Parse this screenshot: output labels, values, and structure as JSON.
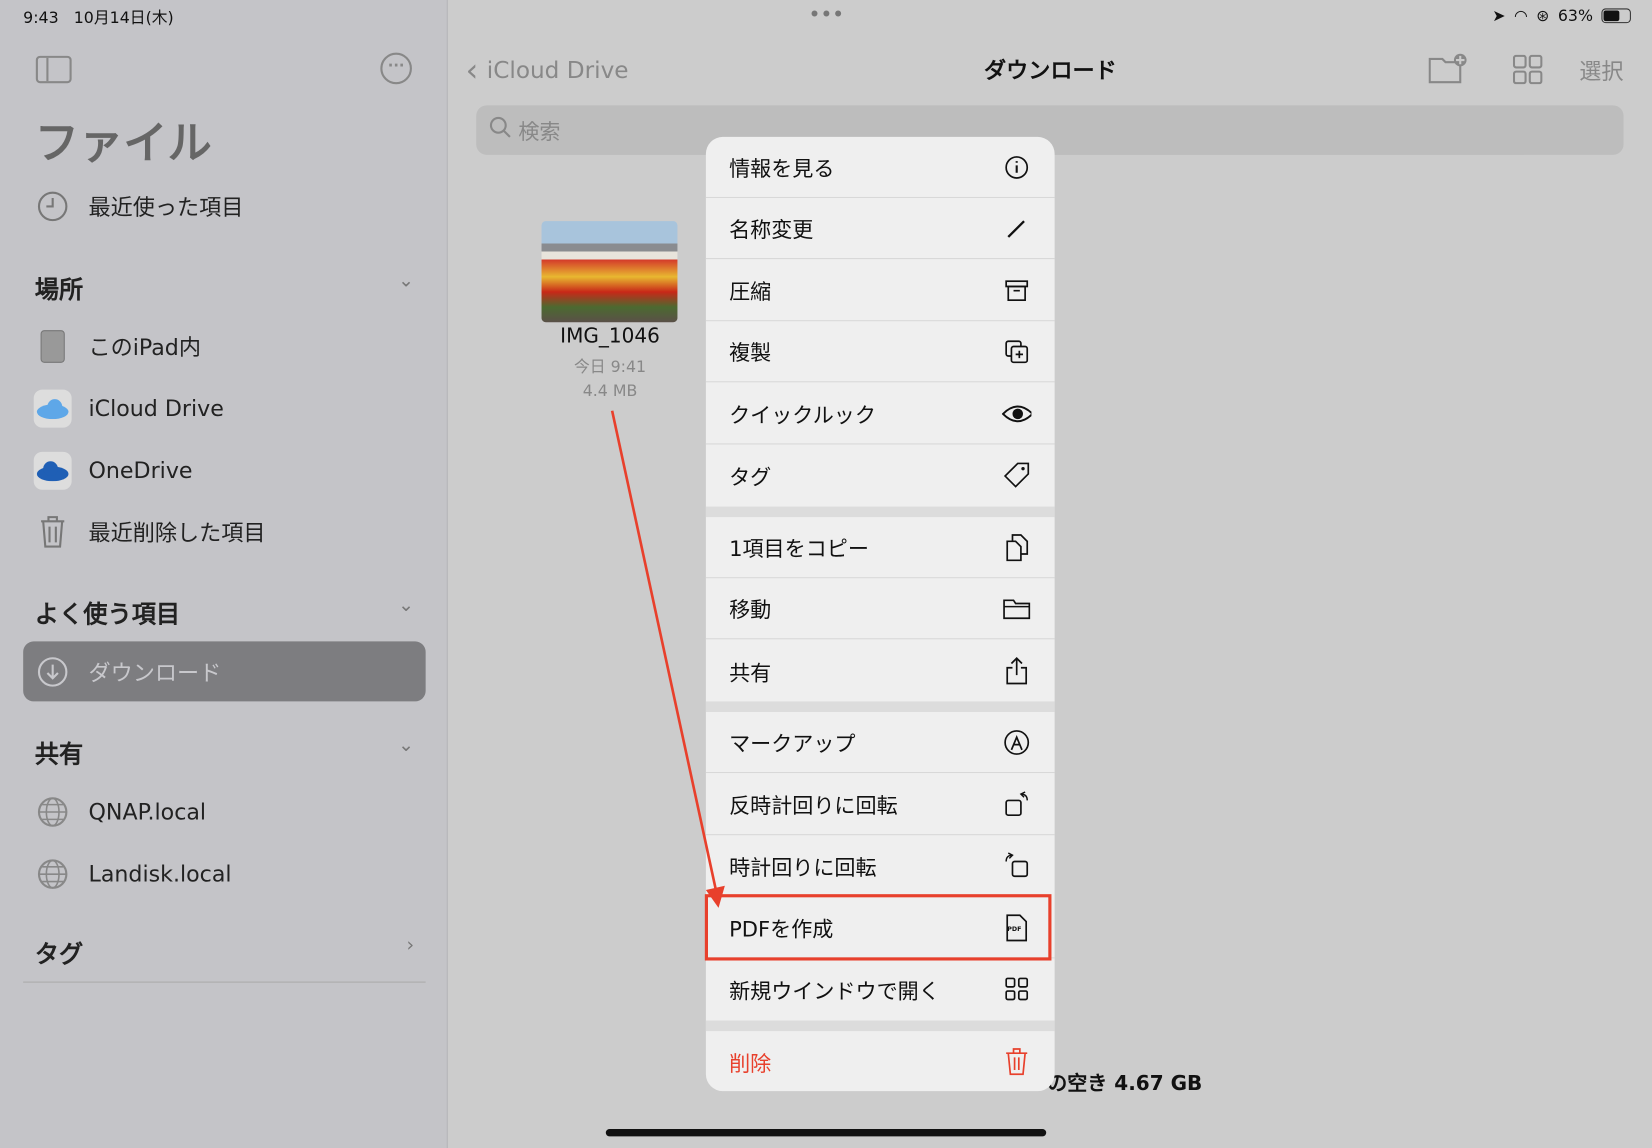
{
  "status_bar": {
    "time": "9:43",
    "date": "10月14日(木)",
    "battery": "63%"
  },
  "sidebar": {
    "title": "ファイル",
    "recent": "最近使った項目",
    "locations_header": "場所",
    "locations": [
      {
        "label": "このiPad内",
        "icon": "ipad-icon"
      },
      {
        "label": "iCloud Drive",
        "icon": "icloud-icon"
      },
      {
        "label": "OneDrive",
        "icon": "onedrive-icon"
      },
      {
        "label": "最近削除した項目",
        "icon": "trash-icon"
      }
    ],
    "favorites_header": "よく使う項目",
    "favorites": [
      {
        "label": "ダウンロード",
        "icon": "download-icon",
        "selected": true
      }
    ],
    "shared_header": "共有",
    "shared": [
      {
        "label": "QNAP.local",
        "icon": "globe-icon"
      },
      {
        "label": "Landisk.local",
        "icon": "globe-icon"
      }
    ],
    "tags_header": "タグ"
  },
  "nav": {
    "back_label": "iCloud Drive",
    "title": "ダウンロード",
    "select_label": "選択"
  },
  "search": {
    "placeholder": "検索"
  },
  "file": {
    "name": "IMG_1046",
    "date": "今日 9:41",
    "size": "4.4 MB"
  },
  "footer": {
    "storage": "の空き 4.67 GB"
  },
  "menu": {
    "items": [
      {
        "label": "情報を見る",
        "icon": "info-icon"
      },
      {
        "label": "名称変更",
        "icon": "pencil-icon"
      },
      {
        "label": "圧縮",
        "icon": "archive-icon"
      },
      {
        "label": "複製",
        "icon": "duplicate-icon"
      },
      {
        "label": "クイックルック",
        "icon": "eye-icon"
      },
      {
        "label": "タグ",
        "icon": "tag-icon"
      },
      {
        "label": "1項目をコピー",
        "icon": "copy-icon"
      },
      {
        "label": "移動",
        "icon": "folder-icon"
      },
      {
        "label": "共有",
        "icon": "share-icon"
      },
      {
        "label": "マークアップ",
        "icon": "markup-icon"
      },
      {
        "label": "反時計回りに回転",
        "icon": "rotate-left-icon"
      },
      {
        "label": "時計回りに回転",
        "icon": "rotate-right-icon"
      },
      {
        "label": "PDFを作成",
        "icon": "pdf-icon"
      },
      {
        "label": "新規ウインドウで開く",
        "icon": "window-icon"
      },
      {
        "label": "削除",
        "icon": "trash-icon"
      }
    ],
    "pdf_badge": "PDF"
  },
  "colors": {
    "destructive": "#e8402c",
    "annotation": "#e8402c",
    "selected": "#7d7d80"
  }
}
